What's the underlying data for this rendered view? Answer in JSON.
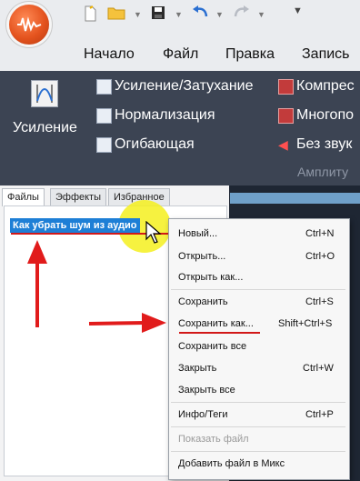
{
  "menubar": {
    "items": [
      "Начало",
      "Файл",
      "Правка",
      "Запись"
    ]
  },
  "ribbon": {
    "big_button_label": "Усиление",
    "column1": [
      "Усиление/Затухание",
      "Нормализация",
      "Огибающая"
    ],
    "column2": [
      "Компрес",
      "Многопо",
      "Без звук"
    ],
    "group_label": "Амплиту"
  },
  "panel": {
    "tabs": [
      "Файлы",
      "Эффекты",
      "Избранное"
    ],
    "file_item": "Как убрать шум из аудио"
  },
  "context_menu": {
    "items": [
      {
        "label": "Новый...",
        "shortcut": "Ctrl+N"
      },
      {
        "label": "Открыть...",
        "shortcut": "Ctrl+O"
      },
      {
        "label": "Открыть как...",
        "shortcut": ""
      },
      {
        "label": "Сохранить",
        "shortcut": "Ctrl+S"
      },
      {
        "label": "Сохранить как...",
        "shortcut": "Shift+Ctrl+S"
      },
      {
        "label": "Сохранить все",
        "shortcut": ""
      },
      {
        "label": "Закрыть",
        "shortcut": "Ctrl+W"
      },
      {
        "label": "Закрыть все",
        "shortcut": ""
      },
      {
        "label": "Инфо/Теги",
        "shortcut": "Ctrl+P"
      },
      {
        "label": "Показать файл",
        "shortcut": ""
      },
      {
        "label": "Добавить файл в Микс",
        "shortcut": ""
      }
    ]
  },
  "colors": {
    "ribbon": "#3c4453",
    "selection": "#1e7fd6",
    "annotation": "#d21818",
    "highlight": "#f4f01e"
  }
}
